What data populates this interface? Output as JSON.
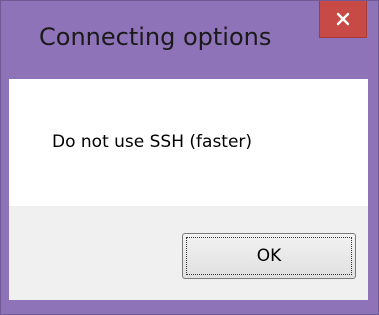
{
  "window": {
    "title": "Connecting options",
    "close_icon": "close-icon",
    "frame_color": "#8f73b8",
    "close_color": "#c84a47"
  },
  "dialog": {
    "message": "Do not use SSH (faster)",
    "ok_label": "OK"
  }
}
